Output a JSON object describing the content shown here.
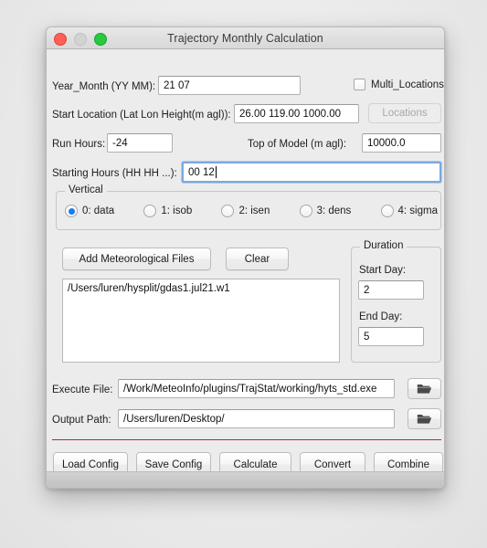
{
  "window": {
    "title": "Trajectory Monthly Calculation",
    "traffic_lights": [
      "close-red",
      "minimize-grey",
      "zoom-green"
    ]
  },
  "fields": {
    "year_month": {
      "label": "Year_Month (YY MM):",
      "value": "21 07"
    },
    "multi_locations": {
      "label": "Multi_Locations",
      "checked": false
    },
    "start_location": {
      "label": "Start Location (Lat Lon Height(m agl)):",
      "value": "26.00 119.00 1000.00"
    },
    "locations_button": {
      "label": "Locations",
      "enabled": false
    },
    "run_hours": {
      "label": "Run Hours:",
      "value": "-24"
    },
    "top_of_model": {
      "label": "Top of Model (m agl):",
      "value": "10000.0"
    },
    "starting_hours": {
      "label": "Starting Hours (HH HH ...):",
      "value": "00 12",
      "focused": true
    }
  },
  "vertical": {
    "legend": "Vertical",
    "selected_index": 0,
    "options": [
      "0: data",
      "1: isob",
      "2: isen",
      "3: dens",
      "4: sigma"
    ]
  },
  "meteo": {
    "add_button": "Add Meteorological Files",
    "clear_button": "Clear",
    "files": [
      "/Users/luren/hysplit/gdas1.jul21.w1"
    ]
  },
  "duration": {
    "legend": "Duration",
    "start_day_label": "Start Day:",
    "start_day_value": "2",
    "end_day_label": "End Day:",
    "end_day_value": "5"
  },
  "paths": {
    "execute_file": {
      "label": "Execute File:",
      "value": "/Work/MeteoInfo/plugins/TrajStat/working/hyts_std.exe",
      "browse_icon": "folder-open-icon"
    },
    "output_path": {
      "label": "Output Path:",
      "value": "/Users/luren/Desktop/",
      "browse_icon": "folder-open-icon"
    }
  },
  "actions": [
    "Load Config",
    "Save Config",
    "Calculate",
    "Convert",
    "Combine"
  ],
  "colors": {
    "accent": "#1a7ce8",
    "separator_red": "#a52a42",
    "window_bg": "#ececec",
    "field_bg": "#ffffff"
  }
}
